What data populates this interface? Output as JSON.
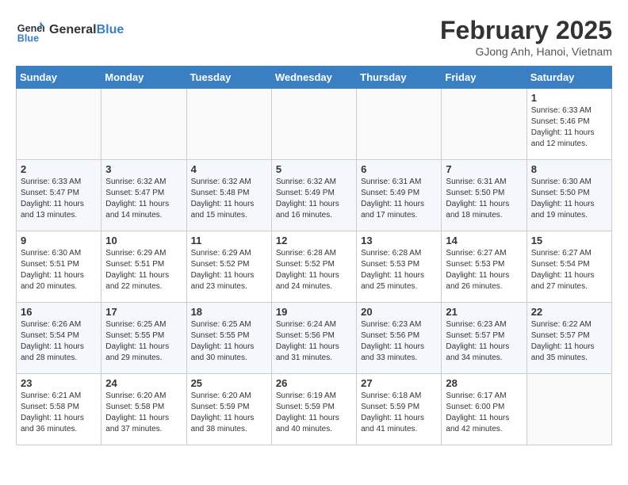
{
  "header": {
    "logo_general": "General",
    "logo_blue": "Blue",
    "month_title": "February 2025",
    "location": "GJong Anh, Hanoi, Vietnam"
  },
  "days_of_week": [
    "Sunday",
    "Monday",
    "Tuesday",
    "Wednesday",
    "Thursday",
    "Friday",
    "Saturday"
  ],
  "weeks": [
    [
      {
        "day": "",
        "info": ""
      },
      {
        "day": "",
        "info": ""
      },
      {
        "day": "",
        "info": ""
      },
      {
        "day": "",
        "info": ""
      },
      {
        "day": "",
        "info": ""
      },
      {
        "day": "",
        "info": ""
      },
      {
        "day": "1",
        "info": "Sunrise: 6:33 AM\nSunset: 5:46 PM\nDaylight: 11 hours and 12 minutes."
      }
    ],
    [
      {
        "day": "2",
        "info": "Sunrise: 6:33 AM\nSunset: 5:47 PM\nDaylight: 11 hours and 13 minutes."
      },
      {
        "day": "3",
        "info": "Sunrise: 6:32 AM\nSunset: 5:47 PM\nDaylight: 11 hours and 14 minutes."
      },
      {
        "day": "4",
        "info": "Sunrise: 6:32 AM\nSunset: 5:48 PM\nDaylight: 11 hours and 15 minutes."
      },
      {
        "day": "5",
        "info": "Sunrise: 6:32 AM\nSunset: 5:49 PM\nDaylight: 11 hours and 16 minutes."
      },
      {
        "day": "6",
        "info": "Sunrise: 6:31 AM\nSunset: 5:49 PM\nDaylight: 11 hours and 17 minutes."
      },
      {
        "day": "7",
        "info": "Sunrise: 6:31 AM\nSunset: 5:50 PM\nDaylight: 11 hours and 18 minutes."
      },
      {
        "day": "8",
        "info": "Sunrise: 6:30 AM\nSunset: 5:50 PM\nDaylight: 11 hours and 19 minutes."
      }
    ],
    [
      {
        "day": "9",
        "info": "Sunrise: 6:30 AM\nSunset: 5:51 PM\nDaylight: 11 hours and 20 minutes."
      },
      {
        "day": "10",
        "info": "Sunrise: 6:29 AM\nSunset: 5:51 PM\nDaylight: 11 hours and 22 minutes."
      },
      {
        "day": "11",
        "info": "Sunrise: 6:29 AM\nSunset: 5:52 PM\nDaylight: 11 hours and 23 minutes."
      },
      {
        "day": "12",
        "info": "Sunrise: 6:28 AM\nSunset: 5:52 PM\nDaylight: 11 hours and 24 minutes."
      },
      {
        "day": "13",
        "info": "Sunrise: 6:28 AM\nSunset: 5:53 PM\nDaylight: 11 hours and 25 minutes."
      },
      {
        "day": "14",
        "info": "Sunrise: 6:27 AM\nSunset: 5:53 PM\nDaylight: 11 hours and 26 minutes."
      },
      {
        "day": "15",
        "info": "Sunrise: 6:27 AM\nSunset: 5:54 PM\nDaylight: 11 hours and 27 minutes."
      }
    ],
    [
      {
        "day": "16",
        "info": "Sunrise: 6:26 AM\nSunset: 5:54 PM\nDaylight: 11 hours and 28 minutes."
      },
      {
        "day": "17",
        "info": "Sunrise: 6:25 AM\nSunset: 5:55 PM\nDaylight: 11 hours and 29 minutes."
      },
      {
        "day": "18",
        "info": "Sunrise: 6:25 AM\nSunset: 5:55 PM\nDaylight: 11 hours and 30 minutes."
      },
      {
        "day": "19",
        "info": "Sunrise: 6:24 AM\nSunset: 5:56 PM\nDaylight: 11 hours and 31 minutes."
      },
      {
        "day": "20",
        "info": "Sunrise: 6:23 AM\nSunset: 5:56 PM\nDaylight: 11 hours and 33 minutes."
      },
      {
        "day": "21",
        "info": "Sunrise: 6:23 AM\nSunset: 5:57 PM\nDaylight: 11 hours and 34 minutes."
      },
      {
        "day": "22",
        "info": "Sunrise: 6:22 AM\nSunset: 5:57 PM\nDaylight: 11 hours and 35 minutes."
      }
    ],
    [
      {
        "day": "23",
        "info": "Sunrise: 6:21 AM\nSunset: 5:58 PM\nDaylight: 11 hours and 36 minutes."
      },
      {
        "day": "24",
        "info": "Sunrise: 6:20 AM\nSunset: 5:58 PM\nDaylight: 11 hours and 37 minutes."
      },
      {
        "day": "25",
        "info": "Sunrise: 6:20 AM\nSunset: 5:59 PM\nDaylight: 11 hours and 38 minutes."
      },
      {
        "day": "26",
        "info": "Sunrise: 6:19 AM\nSunset: 5:59 PM\nDaylight: 11 hours and 40 minutes."
      },
      {
        "day": "27",
        "info": "Sunrise: 6:18 AM\nSunset: 5:59 PM\nDaylight: 11 hours and 41 minutes."
      },
      {
        "day": "28",
        "info": "Sunrise: 6:17 AM\nSunset: 6:00 PM\nDaylight: 11 hours and 42 minutes."
      },
      {
        "day": "",
        "info": ""
      }
    ]
  ]
}
